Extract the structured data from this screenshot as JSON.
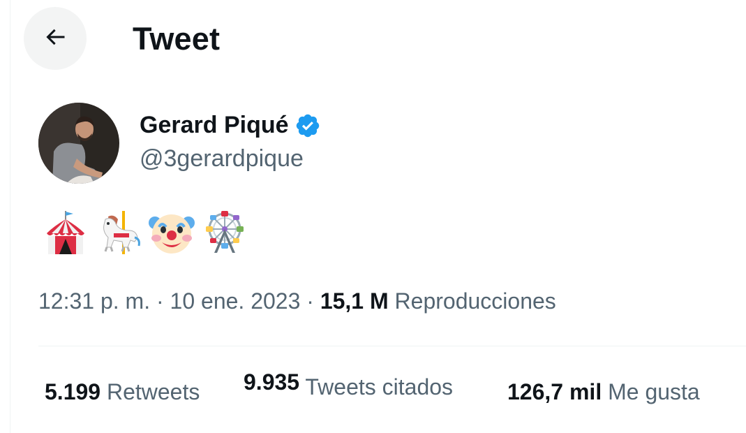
{
  "header": {
    "title": "Tweet",
    "back_icon": "arrow-left-icon"
  },
  "author": {
    "name": "Gerard Piqué",
    "handle": "@3gerardpique",
    "verified_icon": "verified-badge-icon",
    "verified_color": "#1d9bf0"
  },
  "tweet": {
    "emojis": [
      "circus-tent-emoji",
      "carousel-horse-emoji",
      "clown-face-emoji",
      "ferris-wheel-emoji"
    ],
    "time": "12:31 p. m.",
    "separator": "·",
    "date": "10 ene. 2023",
    "views_count": "15,1 M",
    "views_label": "Reproducciones"
  },
  "stats": {
    "retweets_count": "5.199",
    "retweets_label": "Retweets",
    "quotes_count": "9.935",
    "quotes_label": "Tweets citados",
    "likes_count": "126,7 mil",
    "likes_label": "Me gusta"
  },
  "colors": {
    "text_primary": "#0f1419",
    "text_secondary": "#536471",
    "accent": "#1d9bf0",
    "border": "#eff3f4"
  }
}
